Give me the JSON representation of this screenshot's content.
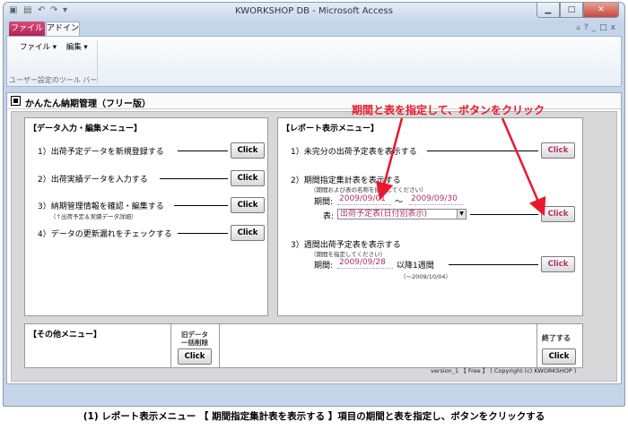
{
  "window": {
    "title": "KWORKSHOP DB - Microsoft Access",
    "qat_icons": [
      "save-icon",
      "undo-icon",
      "redo-icon"
    ],
    "controls": [
      "minimize-icon",
      "maximize-icon",
      "close-icon"
    ]
  },
  "ribbon": {
    "tabs": [
      "ファイル",
      "アドイン"
    ],
    "menus": [
      "ファイル ▾",
      "編集 ▾"
    ],
    "group_label": "ユーザー設定のツール バー"
  },
  "form": {
    "title": "かんたん納期管理（フリー版）",
    "data_panel": {
      "title": "【データ入力・編集メニュー】",
      "items": [
        {
          "label": "1）出荷予定データを新規登録する",
          "sub": "",
          "button": "Click"
        },
        {
          "label": "2）出荷実績データを入力する",
          "sub": "",
          "button": "Click"
        },
        {
          "label": "3）納期管理情報を確認・編集する",
          "sub": "（↑出荷予定＆実績データ詳細）",
          "button": "Click"
        },
        {
          "label": "4）データの更新漏れをチェックする",
          "sub": "",
          "button": "Click"
        }
      ]
    },
    "report_panel": {
      "title": "【レポート表示メニュー】",
      "item1": {
        "label": "1）未完分の出荷予定表を表示する",
        "button": "Click"
      },
      "item2": {
        "label": "2）期間指定集計表を表示する",
        "sub": "（期間および表の名称を指定してください）",
        "period_label": "期間:",
        "date_from": "2009/09/01",
        "tilde": "～",
        "date_to": "2009/09/30",
        "table_label": "表:",
        "table_value": "出荷予定表(日付別表示)",
        "button": "Click"
      },
      "item3": {
        "label": "3）週間出荷予定表を表示する",
        "sub": "（期間を指定してください）",
        "period_label": "期間:",
        "date_from": "2009/09/28",
        "after": "以降1週間",
        "range_note": "（～2009/10/04）",
        "button": "Click"
      }
    },
    "other_panel": {
      "title": "【その他メニュー】",
      "old_data_label_1": "旧データ",
      "old_data_label_2": "一括削除",
      "old_data_button": "Click",
      "exit_label": "終了する",
      "exit_button": "Click"
    },
    "version": "version_1 【 Free 】 ( Copyright (c) KWORKSHOP )"
  },
  "annotation": "期間と表を指定して、ボタンをクリック",
  "caption": "(1) レポート表示メニュー 【 期間指定集計表を表示する 】項目の期間と表を指定し、ボタンをクリックする",
  "colors": {
    "annotation": "#e8192c",
    "file_tab": "#c1306a",
    "field_text": "#b0306a"
  }
}
